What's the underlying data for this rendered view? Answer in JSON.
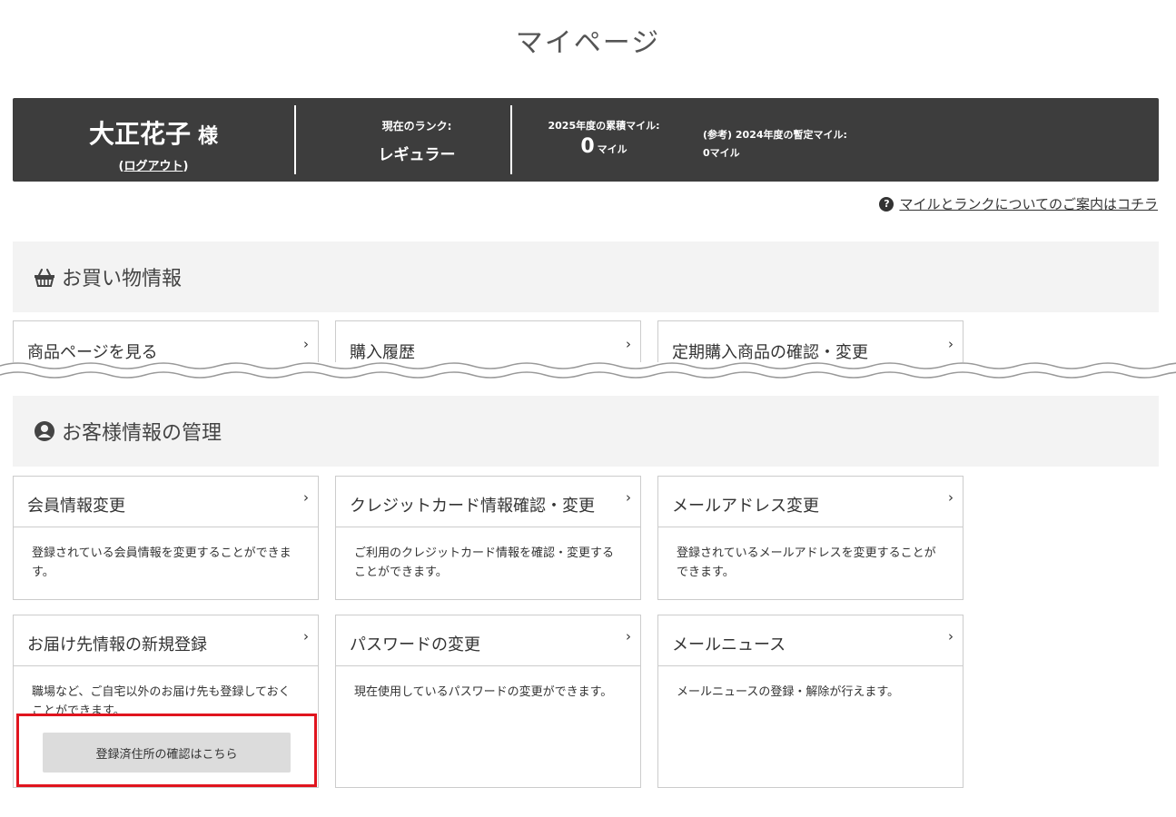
{
  "page": {
    "title": "マイページ"
  },
  "member": {
    "name": "大正花子",
    "honorific": "様",
    "logout_label": "ログアウト",
    "logout_open": "(",
    "logout_close": ")",
    "rank_label": "現在のランク:",
    "rank_value": "レギュラー",
    "miles_label": "2025年度の累積マイル:",
    "miles_value": "0",
    "miles_unit": "マイル",
    "ref_label": "(参考) 2024年度の暫定マイル:",
    "ref_value": "0マイル"
  },
  "help": {
    "label": "マイルとランクについてのご案内はコチラ",
    "icon": "question-circle-icon"
  },
  "shopping": {
    "title": "お買い物情報",
    "icon": "basket-icon",
    "cards": [
      {
        "title": "商品ページを見る"
      },
      {
        "title": "購入履歴"
      },
      {
        "title": "定期購入商品の確認・変更"
      }
    ]
  },
  "customer": {
    "title": "お客様情報の管理",
    "icon": "user-circle-icon",
    "cards": [
      {
        "title": "会員情報変更",
        "desc": "登録されている会員情報を変更することができます。"
      },
      {
        "title": "クレジットカード情報確認・変更",
        "desc": "ご利用のクレジットカード情報を確認・変更することができます。"
      },
      {
        "title": "メールアドレス変更",
        "desc": "登録されているメールアドレスを変更することができます。"
      },
      {
        "title": "お届け先情報の新規登録",
        "desc": "職場など、ご自宅以外のお届け先も登録しておくことができます。"
      },
      {
        "title": "パスワードの変更",
        "desc": "現在使用しているパスワードの変更ができます。"
      },
      {
        "title": "メールニュース",
        "desc": "メールニュースの登録・解除が行えます。"
      }
    ]
  },
  "address_button": {
    "label": "登録済住所の確認はこちら"
  },
  "chevron": "›",
  "colors": {
    "bar": "#3d3d3d",
    "highlight": "#e0141e",
    "section_bg": "#f3f3f3"
  }
}
